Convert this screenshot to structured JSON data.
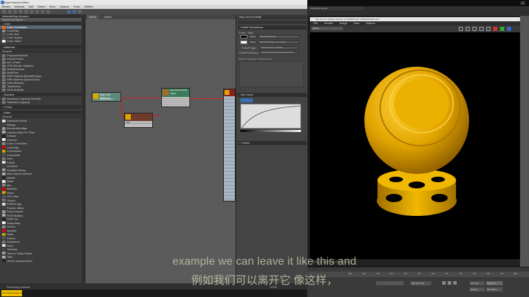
{
  "slate": {
    "title": "Slate Material Editor",
    "menu": [
      "Modes",
      "Material",
      "Edit",
      "Select",
      "View",
      "Options",
      "Tools",
      "Utilities"
    ],
    "browser": {
      "search_placeholder": "Search by Name ...",
      "sections": [
        {
          "label": "Color",
          "items": [
            "Color Correction",
            "ColorMap",
            "Color Key",
            "Color Space",
            "Color Value"
          ]
        },
        {
          "label": "Materials",
          "items": [
            "General",
            "Physical Material",
            "Double Sided",
            "Ink 'n Paint",
            "LPM Render Switcher",
            "Matte/Shadow",
            "Multi/Sub",
            "PBR Material (Metal/Rough)",
            "PBR Material (Spec/Gloss)",
            "Shell Material",
            "Top/Bottom",
            "Shell Material"
          ]
        },
        {
          "label": "Scanline",
          "items": [
            "Advanced Lighting Override",
            "Standard (Legacy)"
          ]
        },
        {
          "label": "V-Ray",
          "items": []
        },
        {
          "label": "Maps",
          "items": [
            "General",
            "Advanced Wood",
            "Bitmap",
            "BlendedBoxMap",
            "Camera Map Per Pixel",
            "Cellular",
            "Checker",
            "Color Correction",
            "ColorMap",
            "Combustion",
            "Composite",
            "Dent",
            "Falloff",
            "Gradient",
            "Gradient Ramp",
            "Map Output Selector",
            "Marble",
            "Mask",
            "Mix",
            "MultiTile",
            "Noise",
            "OSL Map",
            "Output",
            "Particle Age",
            "Particle MBlur",
            "Perlin Marble",
            "RGB Multiply",
            "RGB Tint",
            "ShapeMap",
            "Smoke",
            "Speckle",
            "Splat",
            "Stucco",
            "Substance",
            "Swirl",
            "TextMap",
            "Texture Object Mask",
            "Tiles",
            "Vector Displacement"
          ]
        }
      ]
    },
    "view_tabs": [
      "View1",
      "View2"
    ],
    "nodes": {
      "map1": {
        "title": "Map #14 (Bitmap)",
        "sub": "Bitmap Loader"
      },
      "map2": {
        "title": "Map #144 (Falloff)",
        "sub": "Falloff"
      },
      "map3": {
        "title": "Map #7",
        "sub": ""
      }
    },
    "inspector": {
      "title": "Map #144 (Falloff)",
      "panel_label": "Falloff Parameters",
      "front_side": "Front : Side",
      "row1_value": "100.0",
      "row1_map": "Map #14 (Bitmap)",
      "row2_value": "100.0",
      "row2_map": "Map #140 (Color Correction)",
      "falloff_type_label": "Falloff Type:",
      "falloff_type": "Perpendicular / Parallel",
      "falloff_dir_label": "Falloff Direction:",
      "falloff_dir": "Viewing Direction (Camera Z-Axis)",
      "mode_specific": "Mode Specific Parameters:",
      "mix_curve": "Mix Curve",
      "output": "Output"
    },
    "status": "Rendering finished",
    "zoom": "100%"
  },
  "framebuffer": {
    "title": "Top, frame 0, Display Gamma: 2.2, RGBA Color 16 Bits/Channel (1:1)",
    "tab": "Default Rendering",
    "menu": [
      "File",
      "Render",
      "Image",
      "View",
      "Options"
    ],
    "preset": "Effects",
    "status": "Rendering time: 0:00:00 | Memory used: ..."
  },
  "timeline": {
    "ticks": [
      "680",
      "690",
      "700",
      "710",
      "720",
      "730",
      "740",
      "750",
      "760",
      "770",
      "780",
      "790",
      "800"
    ],
    "auto_key": "Auto Key",
    "selected": "Selected",
    "set_key": "Set Key",
    "key_filters": "Key Filters...",
    "add_time_tag": "Add Time Tag"
  },
  "subtitles": {
    "en": "example we can leave it like this and",
    "zh": "例如我们可以离开它 像这样，"
  },
  "colors": {
    "gold": "#e2a500",
    "wire": "#d42020",
    "accent": "#3b6fb0"
  }
}
